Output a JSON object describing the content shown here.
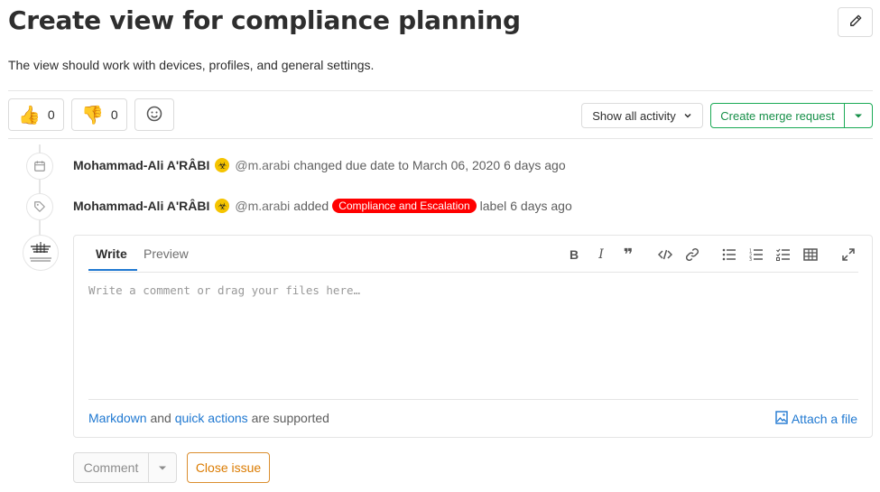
{
  "issue": {
    "title": "Create view for compliance planning",
    "description": "The view should work with devices, profiles, and general settings.",
    "edit_icon": "pencil-icon"
  },
  "reactions": {
    "thumbs_up": {
      "emoji": "👍",
      "count": "0"
    },
    "thumbs_down": {
      "emoji": "👎",
      "count": "0"
    },
    "add_icon": "smiley-icon"
  },
  "actions": {
    "activity_filter": "Show all activity",
    "create_mr": "Create merge request"
  },
  "timeline": [
    {
      "icon": "calendar-icon",
      "author": "Mohammad-Ali A'RÂBI",
      "handle": "@m.arabi",
      "text": "changed due date to March 06, 2020",
      "time": "6 days ago"
    },
    {
      "icon": "tag-icon",
      "author": "Mohammad-Ali A'RÂBI",
      "handle": "@m.arabi",
      "text_before": "added",
      "label": "Compliance and Escalation",
      "text_after": "label",
      "time": "6 days ago"
    }
  ],
  "editor": {
    "tab_write": "Write",
    "tab_preview": "Preview",
    "placeholder": "Write a comment or drag your files here…",
    "footer_markdown": "Markdown",
    "footer_and": "and",
    "footer_quick_actions": "quick actions",
    "footer_supported": "are supported",
    "attach": "Attach a file"
  },
  "buttons": {
    "comment": "Comment",
    "close_issue": "Close issue"
  },
  "colors": {
    "label": "#ff0000",
    "accent_green": "#1aaa55",
    "link_blue": "#1f78d1",
    "warning_orange": "#db8e2f"
  }
}
